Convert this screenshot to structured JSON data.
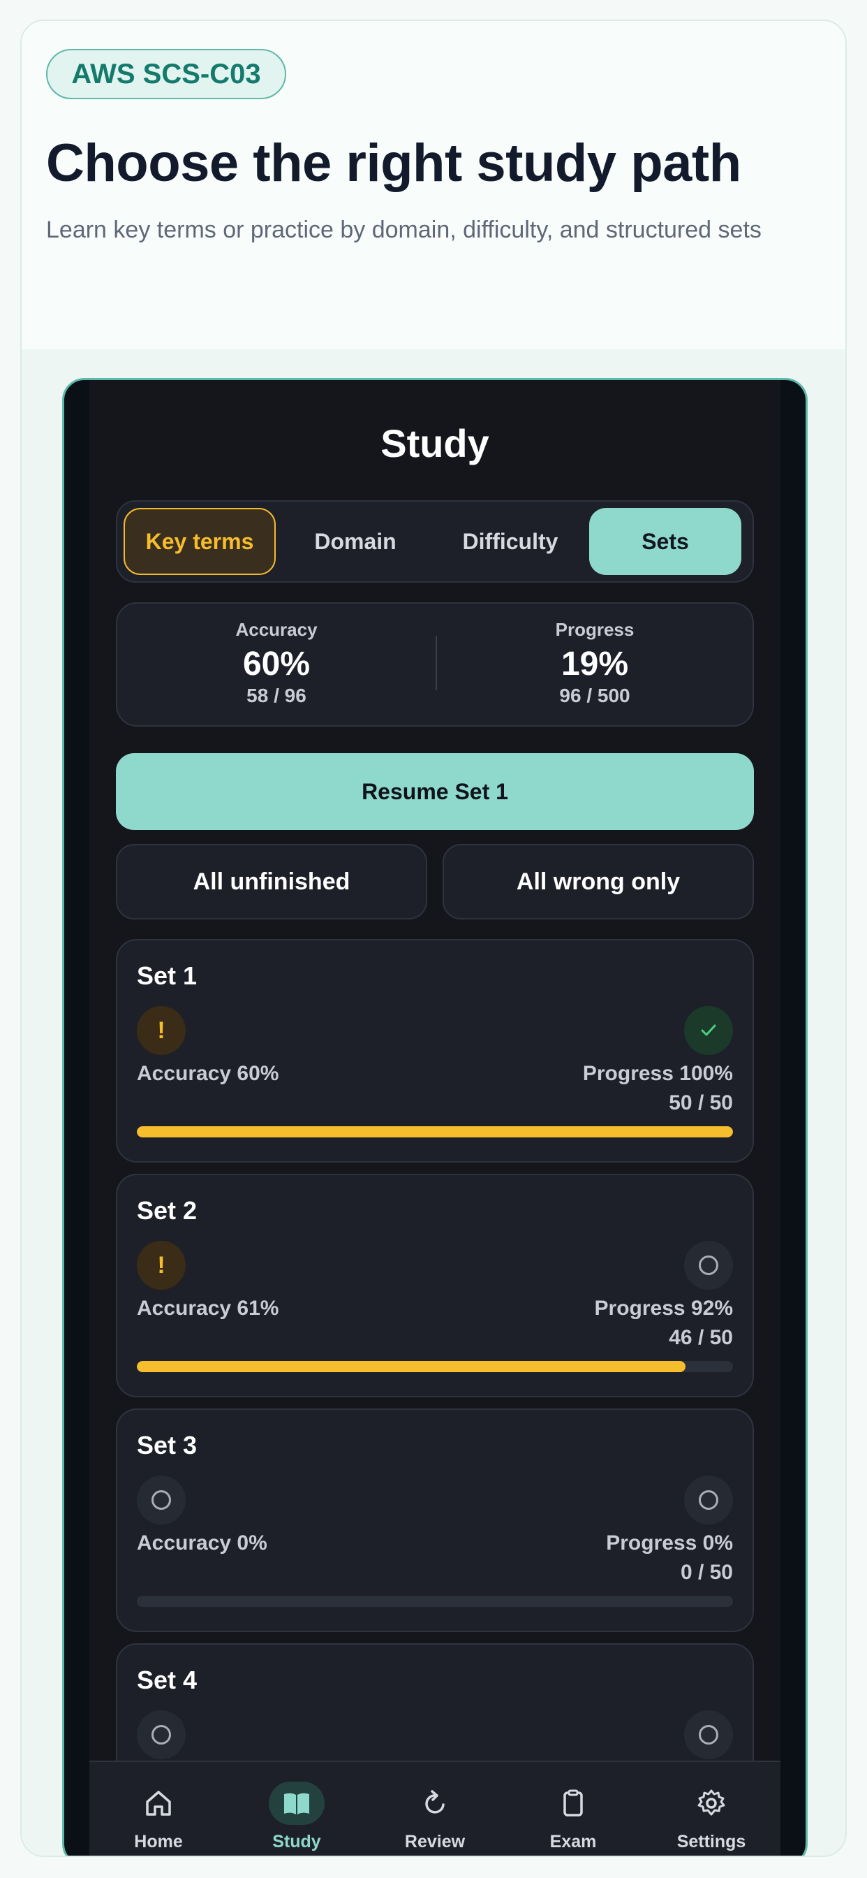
{
  "hero": {
    "badge": "AWS SCS-C03",
    "title": "Choose the right study path",
    "subtitle": "Learn key terms or practice by domain, difficulty, and structured sets"
  },
  "screen": {
    "title": "Study",
    "segments": [
      "Key terms",
      "Domain",
      "Difficulty",
      "Sets"
    ],
    "active_segment": "Sets",
    "highlighted_segment": "Key terms"
  },
  "stats": {
    "accuracy": {
      "label": "Accuracy",
      "value": "60%",
      "count": "58 / 96"
    },
    "progress": {
      "label": "Progress",
      "value": "19%",
      "count": "96 / 500"
    }
  },
  "actions": {
    "resume": "Resume Set 1",
    "all_unfinished": "All unfinished",
    "all_wrong_only": "All wrong only"
  },
  "sets": [
    {
      "title": "Set 1",
      "accuracy": "Accuracy 60%",
      "progress": "Progress 100%",
      "count": "50 / 50",
      "fill": 1.0,
      "left_badge": "warning",
      "right_badge": "done"
    },
    {
      "title": "Set 2",
      "accuracy": "Accuracy 61%",
      "progress": "Progress 92%",
      "count": "46 / 50",
      "fill": 0.92,
      "left_badge": "warning",
      "right_badge": "empty"
    },
    {
      "title": "Set 3",
      "accuracy": "Accuracy 0%",
      "progress": "Progress 0%",
      "count": "0 / 50",
      "fill": 0.0,
      "left_badge": "empty",
      "right_badge": "empty"
    },
    {
      "title": "Set 4",
      "left_badge": "empty",
      "right_badge": "empty"
    }
  ],
  "tabbar": {
    "items": [
      {
        "label": "Home",
        "icon": "home-icon"
      },
      {
        "label": "Study",
        "icon": "book-icon",
        "active": true
      },
      {
        "label": "Review",
        "icon": "refresh-icon"
      },
      {
        "label": "Exam",
        "icon": "clipboard-icon"
      },
      {
        "label": "Settings",
        "icon": "gear-icon"
      }
    ]
  },
  "colors": {
    "accent": "#8fd8cc",
    "warning": "#f6bd2d",
    "success": "#4cd07d",
    "card": "#1d2029",
    "screen": "#14161c"
  }
}
